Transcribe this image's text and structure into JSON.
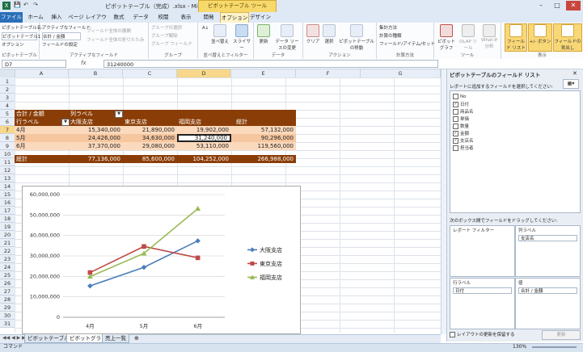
{
  "window": {
    "title": "ピボットテーブル（完成）.xlsx - Microsoft Excel",
    "context_tab": "ピボットテーブル ツール"
  },
  "tabs": [
    "ファイル",
    "ホーム",
    "挿入",
    "ページ レイアウト",
    "数式",
    "データ",
    "校閲",
    "表示",
    "開発",
    "オプション",
    "デザイン"
  ],
  "ribbon": {
    "pivot": {
      "name_label": "ピボットテーブル名:",
      "name_value": "ピボットテーブル1",
      "options": "オプション",
      "group": "ピボットテーブル"
    },
    "active_field": {
      "label": "アクティブなフィールド:",
      "value": "合計 / 金額",
      "settings": "フィールドの設定",
      "expand": "フィールド全体の展開",
      "collapse": "フィールド全体の折りたたみ",
      "group": "アクティブなフィールド"
    },
    "grouping": {
      "sel": "グループの選択",
      "ungroup": "グループ解除",
      "field": "グループ フィールド",
      "group": "グループ"
    },
    "sort": {
      "sort": "並べ替え",
      "slicer": "スライサー",
      "group": "並べ替えとフィルター"
    },
    "data": {
      "refresh": "更新",
      "source": "データ ソースの変更",
      "group": "データ"
    },
    "actions": {
      "clear": "クリア",
      "select": "選択",
      "move": "ピボットテーブルの移動",
      "group": "アクション"
    },
    "calc": {
      "summary": "集計方法",
      "display": "計算の種類",
      "fields": "フィールド/アイテム/セット",
      "group": "計算方法"
    },
    "tools": {
      "chart": "ピボットグラフ",
      "olap": "OLAP ツール",
      "whatif": "What-If 分析",
      "group": "ツール"
    },
    "show": {
      "fieldlist": "フィールド リスト",
      "buttons": "+/- ボタン",
      "headers": "フィールドの見出し",
      "group": "表示"
    }
  },
  "formula": {
    "cell": "D7",
    "fx": "fx",
    "value": "31240000"
  },
  "columns": [
    "A",
    "B",
    "C",
    "D",
    "E",
    "F",
    "G"
  ],
  "rows": [
    "1",
    "2",
    "3",
    "4",
    "5",
    "6",
    "7",
    "8",
    "9",
    "10",
    "11",
    "12",
    "13",
    "14",
    "15",
    "16",
    "17",
    "18",
    "19",
    "20",
    "21",
    "22",
    "23",
    "24",
    "25",
    "26",
    "27",
    "28",
    "29",
    "30",
    "31"
  ],
  "pivot": {
    "header1": [
      "合計 / 金額",
      "列ラベル"
    ],
    "header2": [
      "行ラベル",
      "大阪支店",
      "東京支店",
      "福岡支店",
      "総計"
    ],
    "rows": [
      [
        "4月",
        "15,340,000",
        "21,890,000",
        "19,902,000",
        "57,132,000"
      ],
      [
        "5月",
        "24,426,000",
        "34,630,000",
        "31,240,000",
        "90,296,000"
      ],
      [
        "6月",
        "37,370,000",
        "29,080,000",
        "53,110,000",
        "119,560,000"
      ]
    ],
    "total": [
      "総計",
      "77,136,000",
      "85,600,000",
      "104,252,000",
      "266,988,000"
    ]
  },
  "chart_data": {
    "type": "line",
    "categories": [
      "4月",
      "5月",
      "6月"
    ],
    "series": [
      {
        "name": "大阪支店",
        "values": [
          15340000,
          24426000,
          37370000
        ],
        "color": "#4a7ebb"
      },
      {
        "name": "東京支店",
        "values": [
          21890000,
          34630000,
          29080000
        ],
        "color": "#be4b48"
      },
      {
        "name": "福岡支店",
        "values": [
          19902000,
          31240000,
          53110000
        ],
        "color": "#98b954"
      }
    ],
    "ylim": [
      0,
      60000000
    ],
    "yticks": [
      "60,000,000",
      "50,000,000",
      "40,000,000",
      "30,000,000",
      "20,000,000",
      "10,000,000",
      "0"
    ],
    "grid": true,
    "legend": "right"
  },
  "panel": {
    "title": "ピボットテーブルのフィールド リスト",
    "subtitle": "レポートに追加するフィールドを選択してください:",
    "fields": [
      {
        "name": "No",
        "checked": false
      },
      {
        "name": "日付",
        "checked": true
      },
      {
        "name": "商品名",
        "checked": false
      },
      {
        "name": "単価",
        "checked": false
      },
      {
        "name": "数量",
        "checked": false
      },
      {
        "name": "金額",
        "checked": true
      },
      {
        "name": "支店名",
        "checked": true
      },
      {
        "name": "担当者",
        "checked": false
      }
    ],
    "drag_hint": "次のボックス間でフィールドをドラッグしてください:",
    "report_filter": "レポート フィルター",
    "col_label": "列ラベル",
    "col_value": "支店名",
    "row_label": "行ラベル",
    "row_value": "日付",
    "values_label": "値",
    "values_value": "合計 / 金額",
    "defer": "レイアウトの更新を保留する",
    "update": "更新"
  },
  "sheets": [
    "ピボットテーブル",
    "ピボットグラフ",
    "売上一覧"
  ],
  "status": {
    "mode": "コマンド",
    "zoom": "130%"
  }
}
